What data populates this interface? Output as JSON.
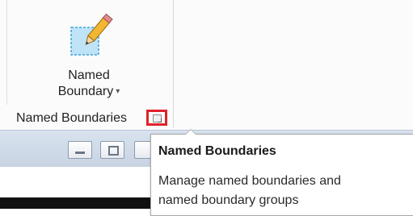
{
  "ribbon": {
    "button": {
      "label_line1": "Named",
      "label_line2": "Boundary",
      "dropdown_glyph": "▾",
      "icon": "named-boundary-pencil-icon"
    },
    "group_label": "Named Boundaries",
    "launcher_icon": "dialog-launcher-icon"
  },
  "window_controls": {
    "minimize_icon": "minimize-icon",
    "maximize_icon": "maximize-icon"
  },
  "tooltip": {
    "title": "Named Boundaries",
    "line1": "Manage named boundaries and",
    "line2": "named boundary groups"
  },
  "colors": {
    "highlight_border": "#e0202a",
    "toolbar_blue": "#c7d3e2"
  }
}
